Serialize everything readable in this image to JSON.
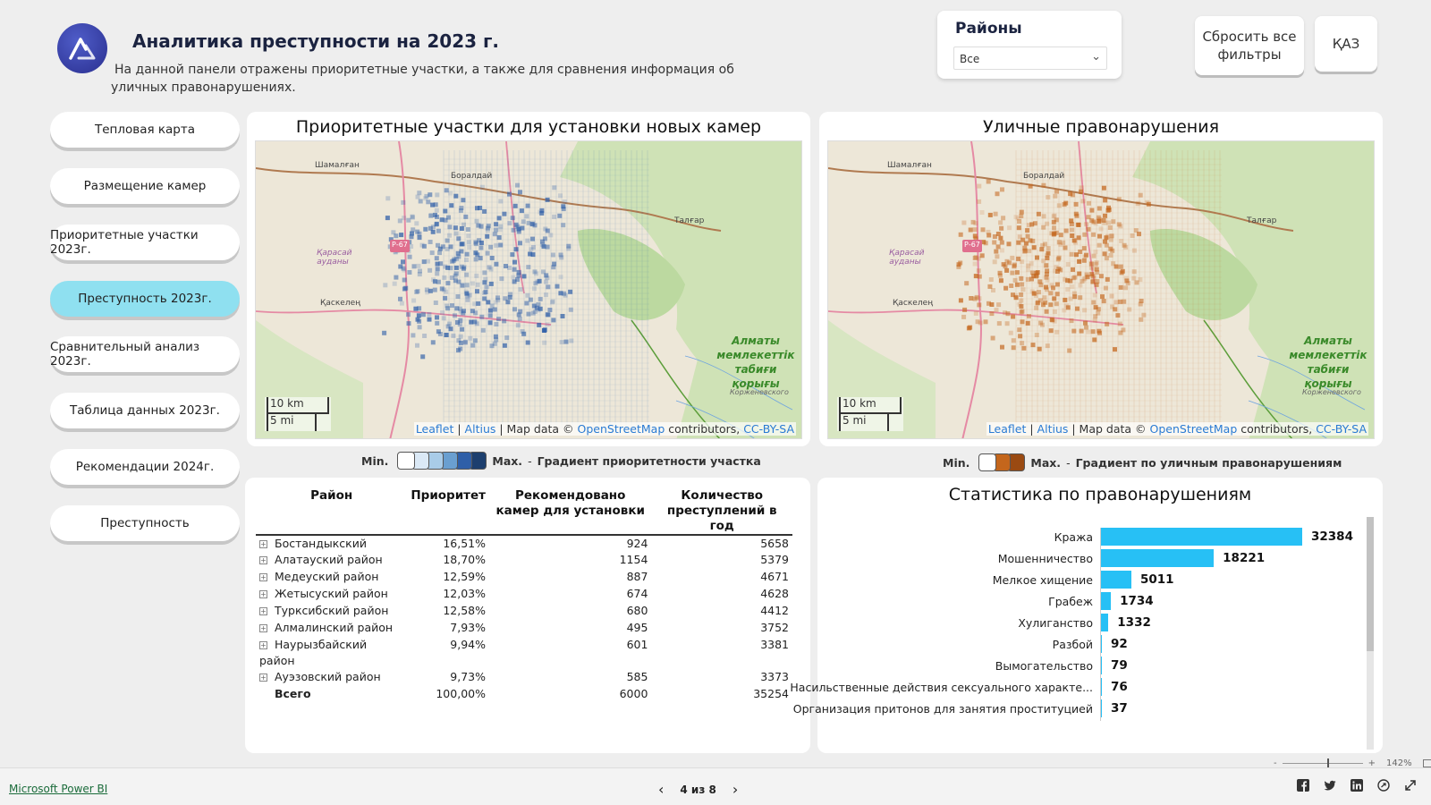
{
  "header": {
    "title": "Аналитика преступности на 2023 г.",
    "subtitle": "На данной панели отражены приоритетные участки, а также для сравнения информация об уличных правонарушениях."
  },
  "filter": {
    "title": "Районы",
    "selected": "Все"
  },
  "buttons": {
    "reset": "Сбросить все фильтры",
    "language": "ҚАЗ"
  },
  "nav": [
    {
      "label": "Тепловая карта",
      "active": false
    },
    {
      "label": "Размещение камер",
      "active": false
    },
    {
      "label": "Приоритетные участки 2023г.",
      "active": false
    },
    {
      "label": "Преступность 2023г.",
      "active": true
    },
    {
      "label": "Сравнительный анализ 2023г.",
      "active": false
    },
    {
      "label": "Таблица данных 2023г.",
      "active": false
    },
    {
      "label": "Рекомендации 2024г.",
      "active": false
    },
    {
      "label": "Преступность",
      "active": false
    }
  ],
  "map_left": {
    "title": "Приоритетные участки для установки новых камер",
    "labels": {
      "shamalgan": "Шамалған",
      "boraldai": "Боралдай",
      "talgar": "Талғар",
      "karasai": "Қарасай ауданы",
      "road": "Р-67",
      "kaskelen": "Қаскелең",
      "reserve": "Алматы мемлекеттік табиғи қорығы",
      "reserve_ru": "Корженевского"
    },
    "scale_km": "10 km",
    "scale_mi": "5 mi",
    "attribution": {
      "leaflet": "Leaflet",
      "sep1": " | ",
      "altius": "Altius",
      "mapdata": " | Map data © ",
      "osm": "OpenStreetMap",
      "contrib": " contributors, ",
      "license": "CC-BY-SA"
    },
    "accent": "#2f5fa8"
  },
  "map_right": {
    "title": "Уличные правонарушения",
    "labels": {
      "shamalgan": "Шамалған",
      "boraldai": "Боралдай",
      "talgar": "Талғар",
      "karasai": "Қарасай ауданы",
      "road": "Р-67",
      "kaskelen": "Қаскелең",
      "reserve": "Алматы мемлекеттік табиғи қорығы",
      "reserve_ru": "Корженевского"
    },
    "scale_km": "10 km",
    "scale_mi": "5 mi",
    "attribution": {
      "leaflet": "Leaflet",
      "sep1": " | ",
      "altius": "Altius",
      "mapdata": " | Map data © ",
      "osm": "OpenStreetMap",
      "contrib": " contributors, ",
      "license": "CC-BY-SA"
    },
    "accent": "#c4661c"
  },
  "legend_left": {
    "min": "Min.",
    "max": "Max.",
    "dash": "-",
    "text": "Градиент приоритетности участка",
    "colors": [
      "#ffffff",
      "#dbe9f6",
      "#a9cce8",
      "#6a9fd0",
      "#2f5fa8",
      "#1d3f6e"
    ]
  },
  "legend_right": {
    "min": "Min.",
    "max": "Max.",
    "dash": "-",
    "text": "Градиент по уличным правонарушениям",
    "colors": [
      "#ffffff",
      "#c4661c",
      "#9a4a12"
    ]
  },
  "table": {
    "headers": [
      "Район",
      "Приоритет",
      "Рекомендовано камер для установки",
      "Количество преступлений в год"
    ],
    "rows": [
      {
        "district": "Бостандыкский",
        "priority": "16,51%",
        "cameras": "924",
        "crimes": "5658"
      },
      {
        "district": "Алатауский район",
        "priority": "18,70%",
        "cameras": "1154",
        "crimes": "5379"
      },
      {
        "district": "Медеуский район",
        "priority": "12,59%",
        "cameras": "887",
        "crimes": "4671"
      },
      {
        "district": "Жетысуский район",
        "priority": "12,03%",
        "cameras": "674",
        "crimes": "4628"
      },
      {
        "district": "Турксибский район",
        "priority": "12,58%",
        "cameras": "680",
        "crimes": "4412"
      },
      {
        "district": "Алмалинский район",
        "priority": "7,93%",
        "cameras": "495",
        "crimes": "3752"
      },
      {
        "district": "Наурызбайский район",
        "priority": "9,94%",
        "cameras": "601",
        "crimes": "3381"
      },
      {
        "district": "Ауэзовский район",
        "priority": "9,73%",
        "cameras": "585",
        "crimes": "3373"
      }
    ],
    "total": {
      "district": "Всего",
      "priority": "100,00%",
      "cameras": "6000",
      "crimes": "35254"
    }
  },
  "chart_data": {
    "type": "bar",
    "orientation": "horizontal",
    "title": "Статистика по правонарушениям",
    "categories": [
      "Кража",
      "Мошенничество",
      "Мелкое хищение",
      "Грабеж",
      "Хулиганство",
      "Разбой",
      "Вымогательство",
      "Насильственные действия сексуального характе...",
      "Организация притонов для занятия проституцией"
    ],
    "values": [
      32384,
      18221,
      5011,
      1734,
      1332,
      92,
      79,
      76,
      37
    ],
    "color": "#27c0f5",
    "xlim": [
      0,
      32384
    ]
  },
  "footer": {
    "powerbi": "Microsoft Power BI",
    "page": "4 из 8",
    "prev": "‹",
    "next": "›",
    "zoom": "142%",
    "minus": "-",
    "plus": "+"
  }
}
